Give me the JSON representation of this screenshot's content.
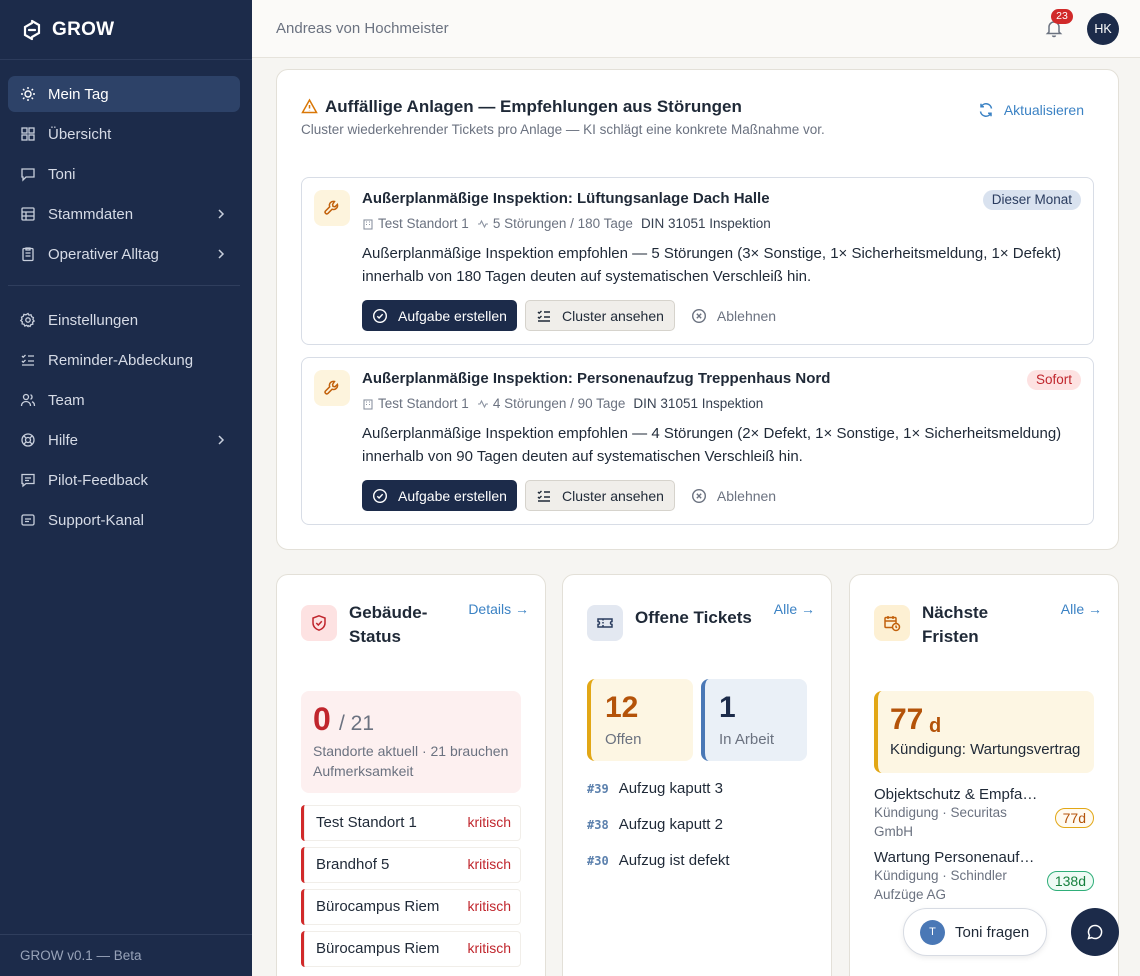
{
  "app": {
    "name": "GROW",
    "version": "GROW v0.1 — Beta"
  },
  "sidebar": {
    "items": [
      {
        "label": "Mein Tag",
        "icon": "sun-icon",
        "active": true
      },
      {
        "label": "Übersicht",
        "icon": "grid-icon"
      },
      {
        "label": "Toni",
        "icon": "chat-icon"
      },
      {
        "label": "Stammdaten",
        "icon": "database-icon",
        "expandable": true
      },
      {
        "label": "Operativer Alltag",
        "icon": "clipboard-icon",
        "expandable": true
      },
      {
        "label": "Einstellungen",
        "icon": "gear-icon"
      },
      {
        "label": "Reminder-Abdeckung",
        "icon": "checklist-icon"
      },
      {
        "label": "Team",
        "icon": "users-icon"
      },
      {
        "label": "Hilfe",
        "icon": "lifebuoy-icon",
        "expandable": true
      },
      {
        "label": "Pilot-Feedback",
        "icon": "feedback-icon"
      },
      {
        "label": "Support-Kanal",
        "icon": "support-icon"
      }
    ]
  },
  "topbar": {
    "user_name": "Andreas von Hochmeister",
    "notifications": "23",
    "avatar_initials": "HK"
  },
  "anlagen": {
    "title": "Auffällige Anlagen — Empfehlungen aus Störungen",
    "subtitle": "Cluster wiederkehrender Tickets pro Anlage — KI schlägt eine konkrete Maßnahme vor.",
    "refresh_label": "Aktualisieren",
    "recommendations": [
      {
        "title": "Außerplanmäßige Inspektion: Lüftungsanlage Dach Halle",
        "badge": "Dieser Monat",
        "site": "Test Standort 1",
        "incidents": "5 Störungen / 180 Tage",
        "norm": "DIN 31051 Inspektion",
        "body": "Außerplanmäßige Inspektion empfohlen — 5 Störungen (3× Sonstige, 1× Sicherheitsmeldung, 1× Defekt) innerhalb von 180 Tagen deuten auf systematischen Verschleiß hin.",
        "actions": {
          "create": "Aufgabe erstellen",
          "view": "Cluster ansehen",
          "reject": "Ablehnen"
        }
      },
      {
        "title": "Außerplanmäßige Inspektion: Personenaufzug Treppenhaus Nord",
        "badge": "Sofort",
        "site": "Test Standort 1",
        "incidents": "4 Störungen / 90 Tage",
        "norm": "DIN 31051 Inspektion",
        "body": "Außerplanmäßige Inspektion empfohlen — 4 Störungen (2× Defekt, 1× Sonstige, 1× Sicherheitsmeldung) innerhalb von 90 Tagen deuten auf systematischen Verschleiß hin.",
        "actions": {
          "create": "Aufgabe erstellen",
          "view": "Cluster ansehen",
          "reject": "Ablehnen"
        }
      }
    ]
  },
  "gebaeude": {
    "title_line1": "Gebäude-",
    "title_line2": "Status",
    "link": "Details →",
    "current": "0",
    "total": "/ 21",
    "description": "Standorte aktuell · 21 brauchen Aufmerksamkeit",
    "sites": [
      {
        "name": "Test Standort 1",
        "state": "kritisch"
      },
      {
        "name": "Brandhof 5",
        "state": "kritisch"
      },
      {
        "name": "Bürocampus Riem",
        "state": "kritisch"
      },
      {
        "name": "Bürocampus Riem",
        "state": "kritisch"
      }
    ]
  },
  "tickets": {
    "title": "Offene Tickets",
    "link": "Alle →",
    "open_count": "12",
    "open_label": "Offen",
    "progress_count": "1",
    "progress_label": "In Arbeit",
    "list": [
      {
        "no": "#39",
        "title": "Aufzug kaputt 3"
      },
      {
        "no": "#38",
        "title": "Aufzug kaputt 2"
      },
      {
        "no": "#30",
        "title": "Aufzug ist defekt"
      }
    ]
  },
  "fristen": {
    "title_line1": "Nächste",
    "title_line2": "Fristen",
    "link": "Alle →",
    "highlight_days": "77",
    "highlight_unit": "d",
    "highlight_text": "Kündigung: Wartungsvertrag",
    "items": [
      {
        "title": "Objektschutz & Empfangsdienst",
        "sub": "Kündigung · Securitas GmbH",
        "days": "77d",
        "tone": "amber"
      },
      {
        "title": "Wartung Personenaufzüge",
        "sub": "Kündigung · Schindler Aufzüge AG",
        "days": "138d",
        "tone": "green"
      }
    ]
  },
  "assistant": {
    "avatar": "T",
    "label": "Toni fragen"
  }
}
